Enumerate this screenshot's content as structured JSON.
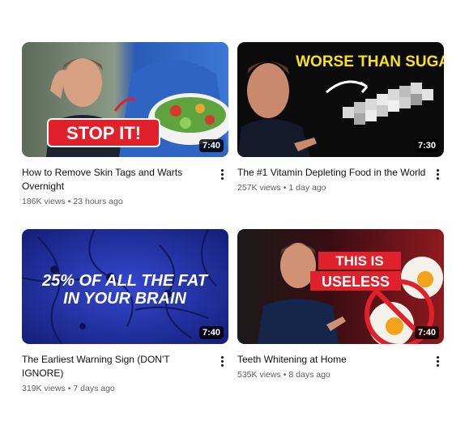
{
  "videos": [
    {
      "title": "How to Remove Skin Tags and Warts Overnight",
      "views": "186K views",
      "age": "23 hours ago",
      "duration": "7:40",
      "thumb_text": "STOP IT!"
    },
    {
      "title": "The #1 Vitamin Depleting Food in the World",
      "views": "257K views",
      "age": "1 day ago",
      "duration": "7:30",
      "thumb_text": "WORSE THAN SUGAR"
    },
    {
      "title": "The Earliest Warning Sign (DON'T IGNORE)",
      "views": "319K views",
      "age": "7 days ago",
      "duration": "7:40",
      "thumb_text_line1": "25% OF ALL THE FAT",
      "thumb_text_line2": "IN YOUR BRAIN"
    },
    {
      "title": "Teeth Whitening at Home",
      "views": "535K views",
      "age": "8 days ago",
      "duration": "7:40",
      "thumb_text_line1": "THIS IS",
      "thumb_text_line2": "USELESS"
    }
  ],
  "separator": "•",
  "colors": {
    "accent_red": "#e0202a",
    "brain_blue": "#1e2fa8",
    "text_secondary": "#606060"
  },
  "icons": {
    "more": "more-vert-icon"
  }
}
